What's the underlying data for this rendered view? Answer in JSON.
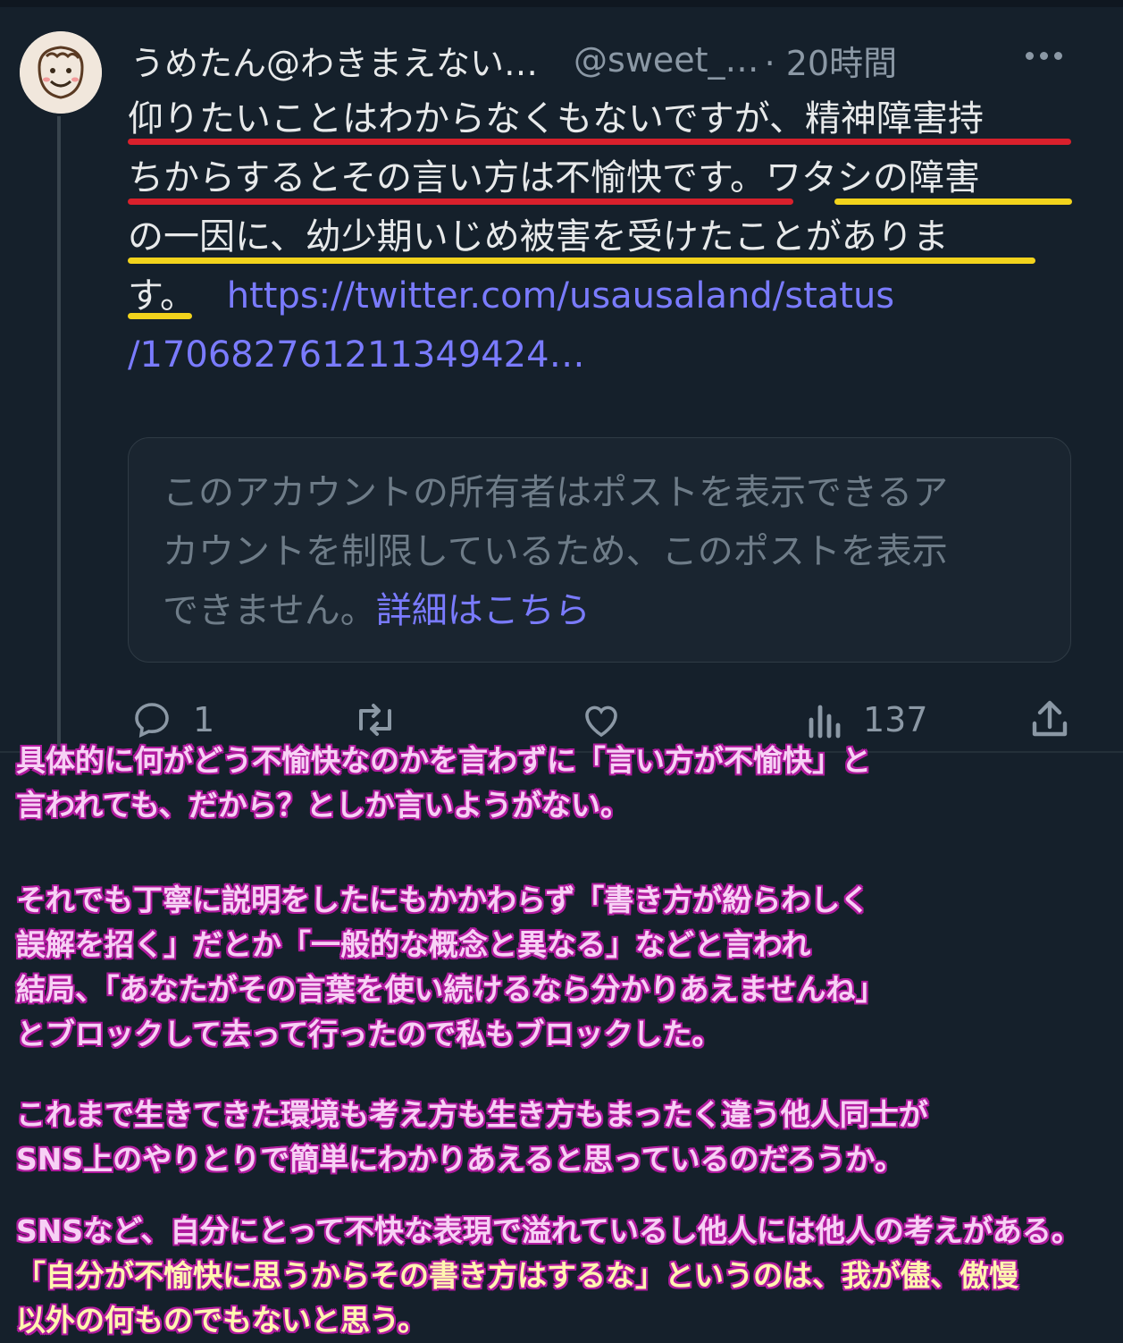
{
  "tweet": {
    "display_name": "うめたん@わきまえない…",
    "handle": "@sweet_…",
    "time": "· 20時間",
    "lines": [
      "仰りたいことはわからなくもないですが、精神障害持",
      "ちからするとその言い方は不愉快です。ワタシの障害",
      "の一因に、幼少期いじめ被害を受けたことがありま",
      "す。"
    ],
    "link_part1": "https://twitter.com/usausaland/status",
    "link_part2": "/170682761211349424…",
    "restricted_notice": {
      "line1": "このアカウントの所有者はポストを表示できるア",
      "line2": "カウントを制限しているため、このポストを表示",
      "line3": "できません。",
      "learn_more": "詳細はこちら"
    },
    "actions": {
      "reply_count": "1",
      "views_count": "137"
    }
  },
  "annotation_colors": {
    "red_underline": "#d9202c",
    "yellow_underline": "#f2d31c",
    "caption_outline": "#b01a9e"
  },
  "commentary": {
    "p1": [
      "具体的に何がどう不愉快なのかを言わずに「言い方が不愉快」と",
      "言われても、だから？としか言いようがない。"
    ],
    "p2": [
      "それでも丁寧に説明をしたにもかかわらず「書き方が紛らわしく",
      "誤解を招く」だとか「一般的な概念と異なる」などと言われ",
      "結局、「あなたがその言葉を使い続けるなら分かりあえませんね」",
      "とブロックして去って行ったので私もブロックした。"
    ],
    "p3": [
      "これまで生きてきた環境も考え方も生き方もまったく違う他人同士が",
      "SNS上のやりとりで簡単にわかりあえると思っているのだろうか。"
    ],
    "p4": [
      "SNSなど、自分にとって不快な表現で溢れているし他人には他人の考えがある。",
      "「自分が不愉快に思うからその書き方はするな」というのは、我が儘、傲慢",
      "以外の何ものでもないと思う。"
    ]
  }
}
